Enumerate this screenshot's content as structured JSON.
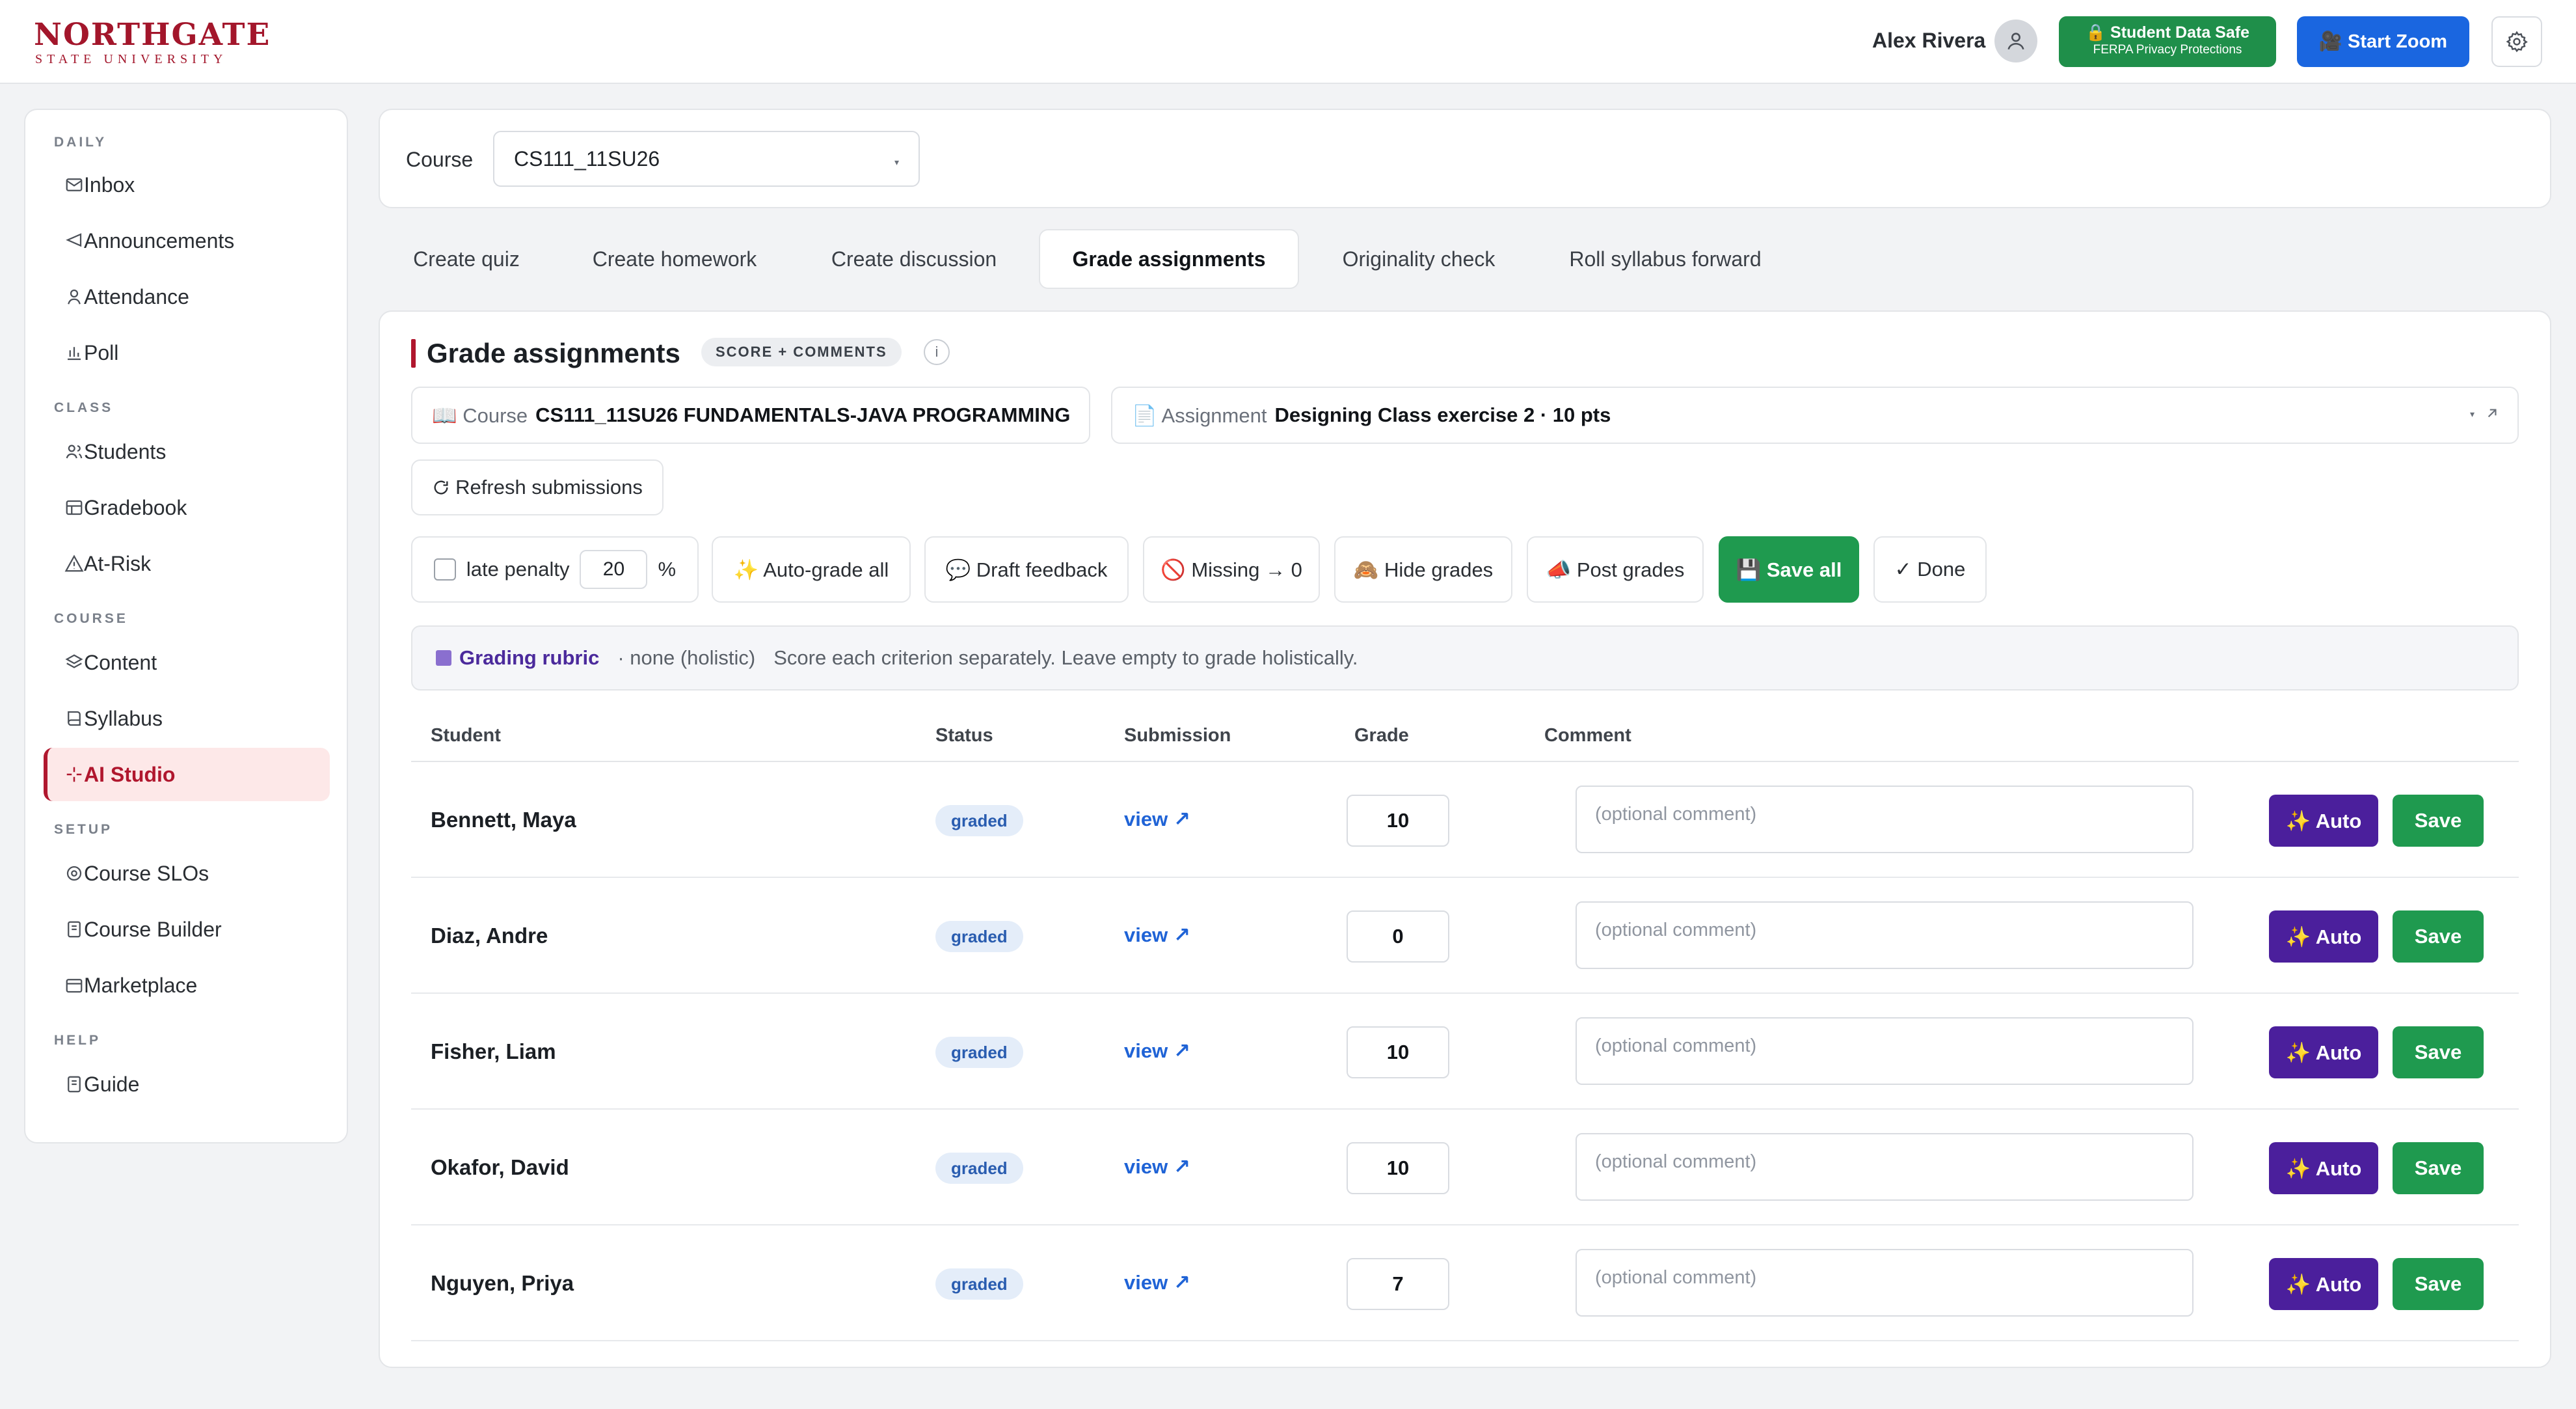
{
  "brand": {
    "name": "NORTHGATE",
    "subtitle": "STATE UNIVERSITY"
  },
  "header": {
    "user_name": "Alex Rivera",
    "ferpa_title": "🔒 Student Data Safe",
    "ferpa_subtitle": "FERPA Privacy Protections",
    "zoom_label": "🎥 Start Zoom",
    "icons": {
      "avatar": "user-icon",
      "settings": "gear-icon"
    }
  },
  "sidebar": {
    "sections": [
      {
        "title": "DAILY",
        "items": [
          {
            "label": "Inbox",
            "icon": "mail-icon"
          },
          {
            "label": "Announcements",
            "icon": "megaphone-icon"
          },
          {
            "label": "Attendance",
            "icon": "person-icon"
          },
          {
            "label": "Poll",
            "icon": "bar-chart-icon"
          }
        ]
      },
      {
        "title": "CLASS",
        "items": [
          {
            "label": "Students",
            "icon": "users-icon"
          },
          {
            "label": "Gradebook",
            "icon": "table-icon"
          },
          {
            "label": "At-Risk",
            "icon": "warning-icon"
          }
        ]
      },
      {
        "title": "COURSE",
        "items": [
          {
            "label": "Content",
            "icon": "layers-icon"
          },
          {
            "label": "Syllabus",
            "icon": "book-icon"
          },
          {
            "label": "AI Studio",
            "icon": "sparkle-icon",
            "active": true
          }
        ]
      },
      {
        "title": "SETUP",
        "items": [
          {
            "label": "Course SLOs",
            "icon": "target-icon"
          },
          {
            "label": "Course Builder",
            "icon": "document-icon"
          },
          {
            "label": "Marketplace",
            "icon": "store-icon"
          }
        ]
      },
      {
        "title": "HELP",
        "items": [
          {
            "label": "Guide",
            "icon": "document-icon"
          }
        ]
      }
    ]
  },
  "course_picker": {
    "label": "Course",
    "selected": "CS111_11SU26"
  },
  "tabs": [
    {
      "label": "Create quiz"
    },
    {
      "label": "Create homework"
    },
    {
      "label": "Create discussion"
    },
    {
      "label": "Grade assignments",
      "active": true
    },
    {
      "label": "Originality check"
    },
    {
      "label": "Roll syllabus forward"
    }
  ],
  "grading": {
    "title": "Grade assignments",
    "mode_badge": "SCORE + COMMENTS",
    "info_glyph": "i",
    "course_label": "📖 Course",
    "course_value": "CS111_11SU26 FUNDAMENTALS-JAVA PROGRAMMING",
    "assignment_label": "📄 Assignment",
    "assignment_value": "Designing Class exercise 2 · 10 pts",
    "refresh_label": "Refresh submissions",
    "late_penalty_label": "late penalty",
    "late_penalty_value": "20",
    "late_penalty_unit": "%",
    "late_penalty_checked": false,
    "actions": {
      "auto_grade_all": "✨ Auto-grade all",
      "draft_feedback": "💬 Draft feedback",
      "missing_zero": "🚫 Missing → 0",
      "hide_grades": "🙈 Hide grades",
      "post_grades": "📣 Post grades",
      "save_all": "💾 Save all",
      "done": "✓ Done"
    },
    "rubric": {
      "title": "Grading rubric",
      "mode": "· none (holistic)",
      "hint": "Score each criterion separately. Leave empty to grade holistically."
    },
    "columns": [
      "Student",
      "Status",
      "Submission",
      "Grade",
      "Comment"
    ],
    "rows": [
      {
        "student": "Bennett, Maya",
        "status": "graded",
        "submission": "view ↗",
        "grade": "10",
        "comment_placeholder": "(optional comment)",
        "auto": "✨ Auto",
        "save": "Save"
      },
      {
        "student": "Diaz, Andre",
        "status": "graded",
        "submission": "view ↗",
        "grade": "0",
        "comment_placeholder": "(optional comment)",
        "auto": "✨ Auto",
        "save": "Save"
      },
      {
        "student": "Fisher, Liam",
        "status": "graded",
        "submission": "view ↗",
        "grade": "10",
        "comment_placeholder": "(optional comment)",
        "auto": "✨ Auto",
        "save": "Save"
      },
      {
        "student": "Okafor, David",
        "status": "graded",
        "submission": "view ↗",
        "grade": "10",
        "comment_placeholder": "(optional comment)",
        "auto": "✨ Auto",
        "save": "Save"
      },
      {
        "student": "Nguyen, Priya",
        "status": "graded",
        "submission": "view ↗",
        "grade": "7",
        "comment_placeholder": "(optional comment)",
        "auto": "✨ Auto",
        "save": "Save"
      }
    ]
  },
  "colors": {
    "brand": "#a3162b",
    "accent_green": "#1f9a4f",
    "accent_blue": "#1a66e0",
    "accent_purple": "#4b1f9c"
  }
}
